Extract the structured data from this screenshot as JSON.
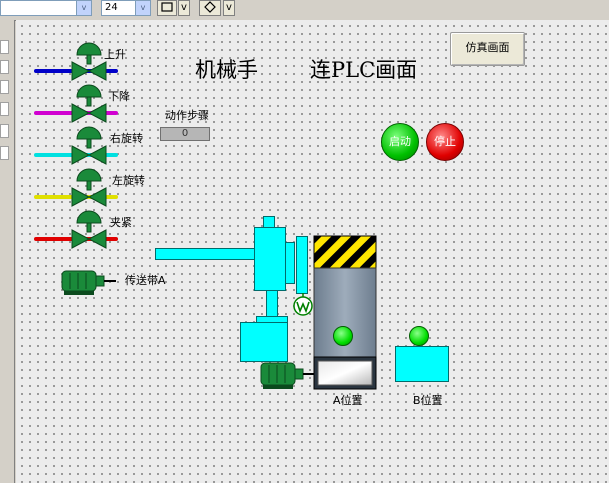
{
  "toolbar": {
    "font_size_value": "24",
    "dropdown_arrow": "v",
    "button_a_label": "v",
    "button_b_label": "v"
  },
  "screen": {
    "title_left": "机械手",
    "title_right": "连PLC画面",
    "sim_button_label": "仿真画面",
    "step_label": "动作步骤",
    "step_value": "0",
    "start_button_label": "启动",
    "stop_button_label": "停止"
  },
  "valves": [
    {
      "label": "上升",
      "color": "#0000c8"
    },
    {
      "label": "下降",
      "color": "#d000d0"
    },
    {
      "label": "右旋转",
      "color": "#00e0e0"
    },
    {
      "label": "左旋转",
      "color": "#e0e000"
    },
    {
      "label": "夹紧",
      "color": "#e00000"
    }
  ],
  "conveyor": {
    "label": "传送带A"
  },
  "positions": {
    "a_label": "A位置",
    "b_label": "B位置"
  },
  "colors": {
    "machine": "#00ffff",
    "valve_green": "#1a8a3a",
    "indicator_green": "#00dd00",
    "start_green": "#00c000",
    "stop_red": "#e00000"
  },
  "icons": {
    "valve": "valve-icon",
    "motor": "motor-icon",
    "gripper": "gripper-icon"
  }
}
